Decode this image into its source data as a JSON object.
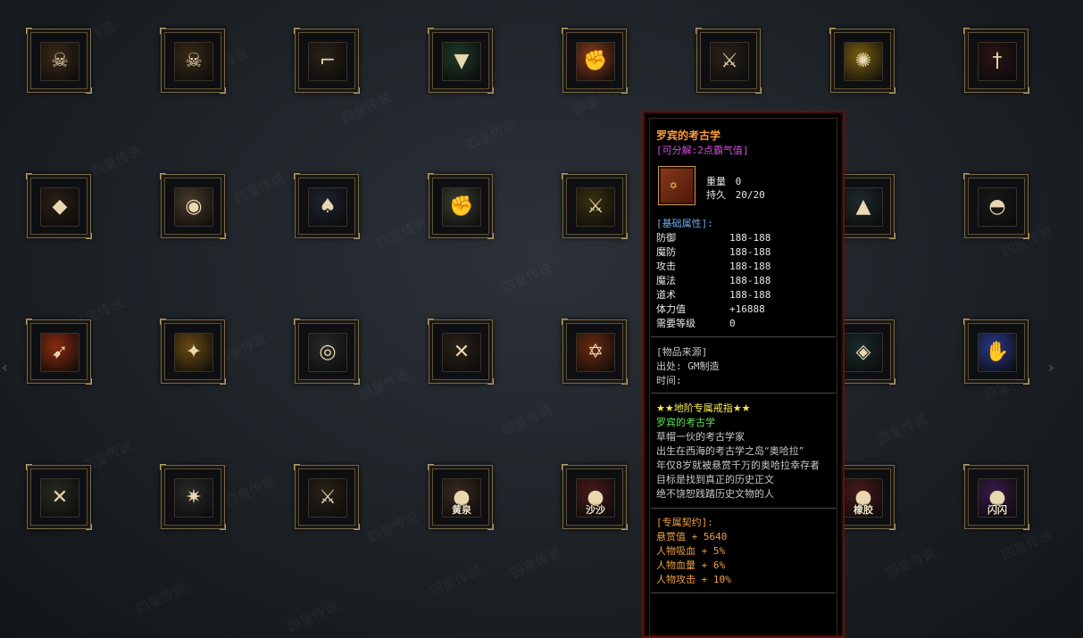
{
  "grid": {
    "rows": [
      [
        {
          "name": "pirate-hat-skull-icon",
          "glyph": "☠",
          "bg": "#3a2a18"
        },
        {
          "name": "pirate-hat-skull-icon",
          "glyph": "☠",
          "bg": "#3a2a18"
        },
        {
          "name": "flintlock-pistol-icon",
          "glyph": "⌐",
          "bg": "#2a2218"
        },
        {
          "name": "green-cloak-icon",
          "glyph": "▼",
          "bg": "#1e3a2a"
        },
        {
          "name": "flame-fist-icon",
          "glyph": "✊",
          "bg": "#8a3a1a"
        },
        {
          "name": "curved-dagger-icon",
          "glyph": "⚔",
          "bg": "#2a2218"
        },
        {
          "name": "golden-swirl-icon",
          "glyph": "✺",
          "bg": "#7a6010"
        },
        {
          "name": "red-sword-icon",
          "glyph": "†",
          "bg": "#2a1414"
        }
      ],
      [
        {
          "name": "dark-armor-icon",
          "glyph": "◆",
          "bg": "#2a1e14"
        },
        {
          "name": "soup-bowl-icon",
          "glyph": "◉",
          "bg": "#4a3a2a"
        },
        {
          "name": "black-suit-icon",
          "glyph": "♠",
          "bg": "#1e2430"
        },
        {
          "name": "stone-fist-icon",
          "glyph": "✊",
          "bg": "#3a4030"
        },
        {
          "name": "golden-blade-icon",
          "glyph": "⚔",
          "bg": "#3a3010"
        },
        {
          "name": "hidden-item-icon",
          "glyph": "",
          "bg": "#0d0f12"
        },
        {
          "name": "dark-hat-icon",
          "glyph": "▲",
          "bg": "#1e2a2a"
        },
        {
          "name": "straw-hat-icon",
          "glyph": "◓",
          "bg": "#1a1a1a"
        }
      ],
      [
        {
          "name": "fire-kick-icon",
          "glyph": "➹",
          "bg": "#8a2a10"
        },
        {
          "name": "golden-scroll-icon",
          "glyph": "✦",
          "bg": "#6a4a10"
        },
        {
          "name": "goggles-icon",
          "glyph": "◎",
          "bg": "#2a2a2a"
        },
        {
          "name": "crossed-swords-icon",
          "glyph": "✕",
          "bg": "#2a2218"
        },
        {
          "name": "archaeology-book-icon",
          "glyph": "✡",
          "bg": "#6a2a10"
        },
        {
          "name": "hidden-item-icon",
          "glyph": "",
          "bg": "#0d0f12"
        },
        {
          "name": "dark-chest-armor-icon",
          "glyph": "◈",
          "bg": "#1a2a2a"
        },
        {
          "name": "blue-light-palm-icon",
          "glyph": "✋",
          "bg": "#2a3a8a"
        }
      ],
      [
        {
          "name": "twin-blades-icon",
          "glyph": "✕",
          "bg": "#2a2a22"
        },
        {
          "name": "spiked-club-icon",
          "glyph": "✷",
          "bg": "#2a2a2a"
        },
        {
          "name": "curved-dagger-icon",
          "glyph": "⚔",
          "bg": "#2a2218"
        },
        {
          "name": "devil-fruit-yellow-springs-icon",
          "glyph": "●",
          "bg": "#3a2a1e",
          "label": "黄泉"
        },
        {
          "name": "devil-fruit-sand-icon",
          "glyph": "●",
          "bg": "#4a1a1a",
          "label": "沙沙"
        },
        {
          "name": "hidden-item-icon",
          "glyph": "",
          "bg": "#0d0f12"
        },
        {
          "name": "devil-fruit-rubber-icon",
          "glyph": "●",
          "bg": "#4a1a1a",
          "label": "橡胶"
        },
        {
          "name": "devil-fruit-flash-icon",
          "glyph": "●",
          "bg": "#3a1a4a",
          "label": "闪闪"
        }
      ]
    ]
  },
  "watermark": "四皇传说",
  "tooltip": {
    "title": "罗宾的考古学",
    "decompose": "[可分解:2点霸气值]",
    "weight_label": "重量",
    "weight_value": "0",
    "durability_label": "持久",
    "durability_value": "20/20",
    "base_attr_header": "[基础属性]:",
    "attributes": [
      {
        "k": "防御",
        "v": "188-188"
      },
      {
        "k": "魔防",
        "v": "188-188"
      },
      {
        "k": "攻击",
        "v": "188-188"
      },
      {
        "k": "魔法",
        "v": "188-188"
      },
      {
        "k": "道术",
        "v": "188-188"
      },
      {
        "k": "体力值",
        "v": "+16888"
      },
      {
        "k": "需要等级",
        "v": "0"
      }
    ],
    "source_header": "[物品来源]",
    "origin_label": "出处:",
    "origin_value": "GM制造",
    "time_label": "时间:",
    "time_value": "",
    "ring_title": "★★地阶专属戒指★★",
    "ring_name": "罗宾的考古学",
    "description": [
      "草帽一伙的考古学家",
      "出生在西海的考古学之岛“奥哈拉”",
      "年仅8岁就被悬赏千万的奥哈拉幸存者",
      "目标是找到真正的历史正文",
      "绝不饶恕践踏历史文物的人"
    ],
    "contract_header": "[专属契约]:",
    "contract": [
      "悬赏值 + 5640",
      "人物吸血 + 5%",
      "人物血量 + 6%",
      "人物攻击 + 10%"
    ]
  },
  "nav": {
    "left_arrow": "‹",
    "right_arrow": "›"
  }
}
